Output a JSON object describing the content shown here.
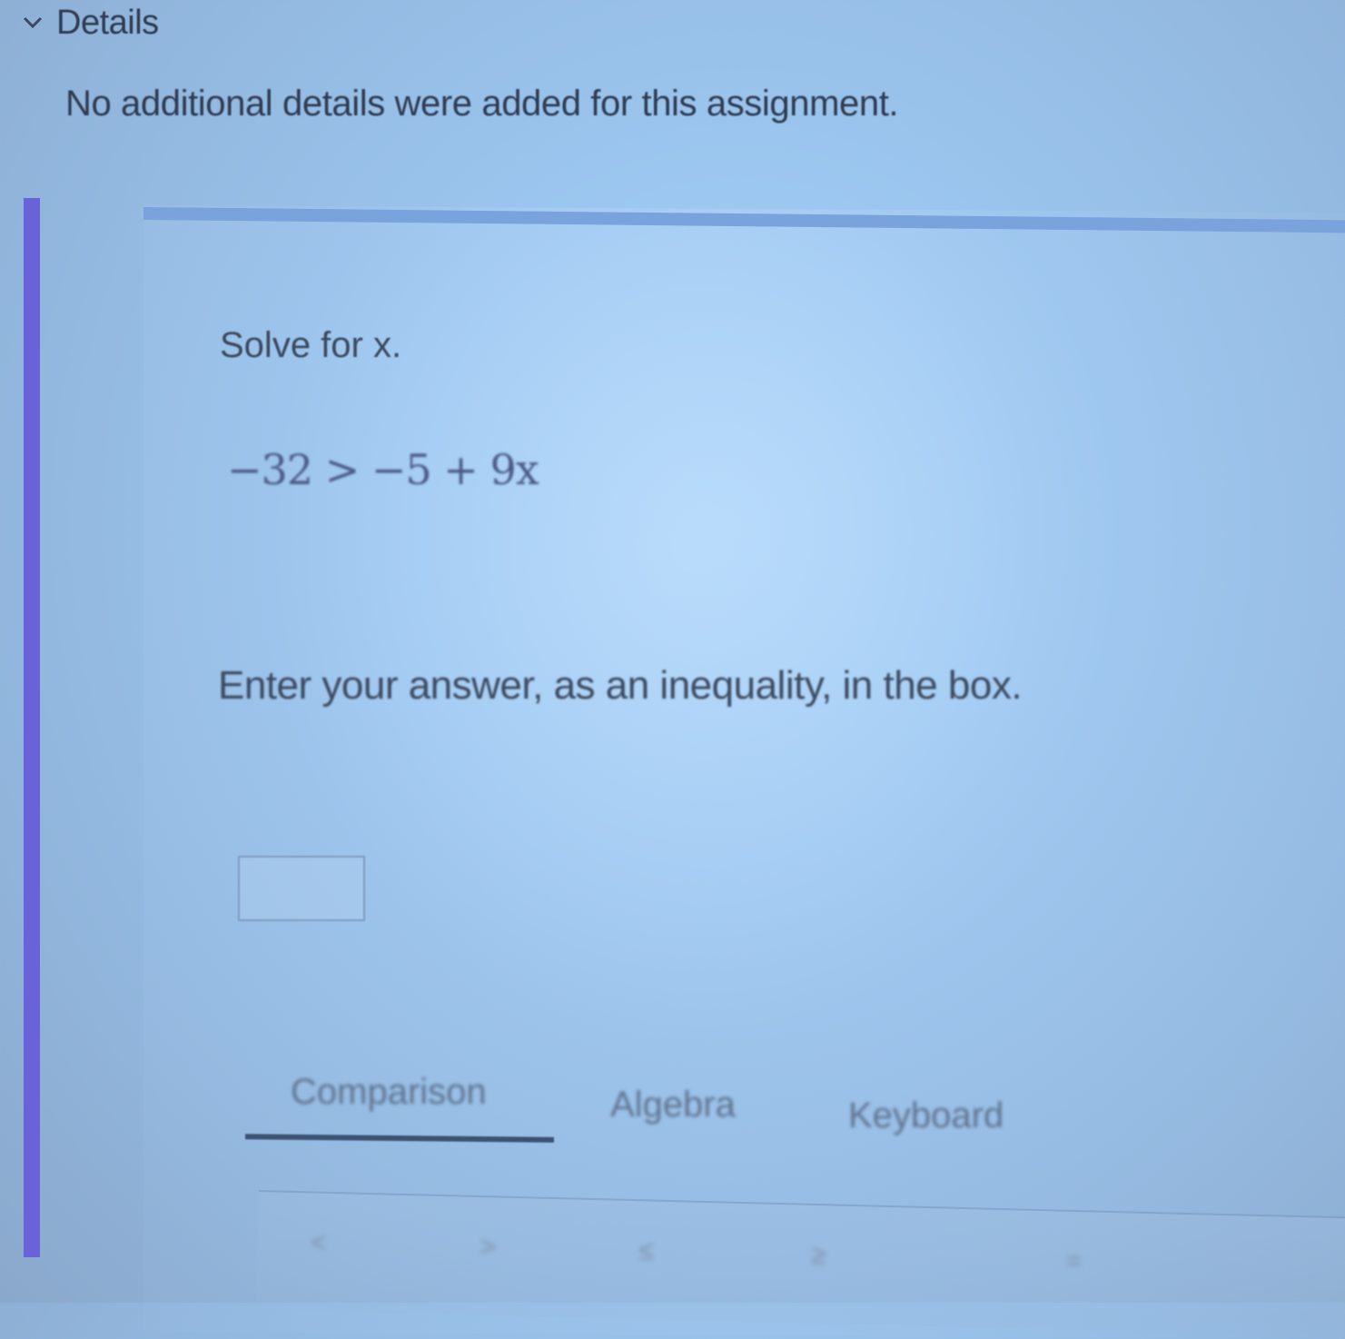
{
  "details": {
    "title": "Details",
    "body": "No additional details were added for this assignment."
  },
  "question": {
    "prompt": "Solve for x.",
    "equation": "−32 > −5 + 9x",
    "instruction": "Enter your answer, as an inequality, in the box.",
    "answer_value": ""
  },
  "tabs": {
    "comparison": "Comparison",
    "algebra": "Algebra",
    "keyboard": "Keyboard",
    "active": "Comparison"
  },
  "keypad": {
    "keys": [
      "<",
      ">",
      "≤",
      "≥",
      "="
    ]
  },
  "colors": {
    "accent_bar": "#6a62d8",
    "card_border": "#7aa2dc",
    "active_tab_underline": "#3c5272"
  },
  "icons": {
    "details_toggle": "chevron-down-icon"
  }
}
